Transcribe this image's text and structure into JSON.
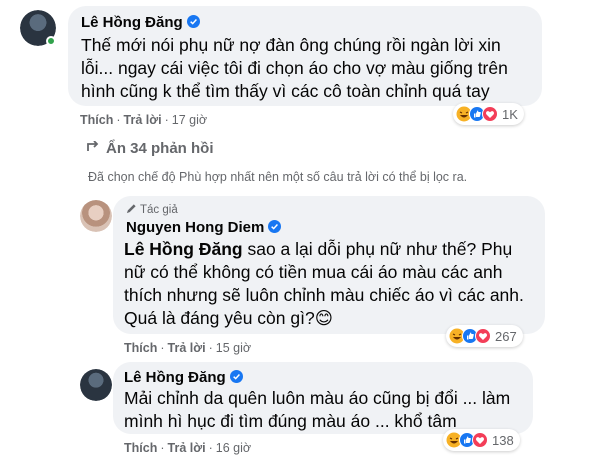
{
  "comments": [
    {
      "author": "Lê Hồng Đăng",
      "text": "Thế mới nói phụ nữ nợ đàn ông chúng rồi ngàn lời xin lỗi... ngay cái việc tôi đi chọn áo cho vợ màu giống trên hình cũng k thể tìm thấy vì các cô toàn chỉnh quá tay",
      "like": "Thích",
      "reply": "Trả lời",
      "time": "17 giờ",
      "reaction_count": "1K"
    },
    {
      "author_tag": "Tác giả",
      "author": "Nguyen Hong Diem",
      "mention": "Lê Hồng Đăng",
      "text": " sao a lại dỗi phụ nữ như thế? Phụ nữ có thể không có tiền mua cái áo màu các anh thích nhưng sẽ luôn chỉnh màu chiếc áo vì các anh. Quá là đáng yêu còn gì?",
      "emoji": "😊",
      "like": "Thích",
      "reply": "Trả lời",
      "time": "15 giờ",
      "reaction_count": "267"
    },
    {
      "author": "Lê Hồng Đăng",
      "text": "Mải chỉnh da quên luôn màu áo cũng bị đổi ... làm mình hì hục đi tìm đúng màu áo ... khổ tâm",
      "like": "Thích",
      "reply": "Trả lời",
      "time": "16 giờ",
      "reaction_count": "138"
    }
  ],
  "hide_replies": "Ẩn 34 phản hồi",
  "filter_note": "Đã chọn chế độ Phù hợp nhất nên một số câu trả lời có thể bị lọc ra.",
  "separator": "·",
  "icons": [
    "verified-badge-icon",
    "haha-reaction-icon",
    "like-reaction-icon",
    "love-reaction-icon",
    "collapse-arrow-icon",
    "author-pen-icon"
  ],
  "colors": {
    "bubble": "#f0f2f5",
    "secondary_text": "#65676b",
    "verified": "#1877f2",
    "online": "#31a24c"
  }
}
